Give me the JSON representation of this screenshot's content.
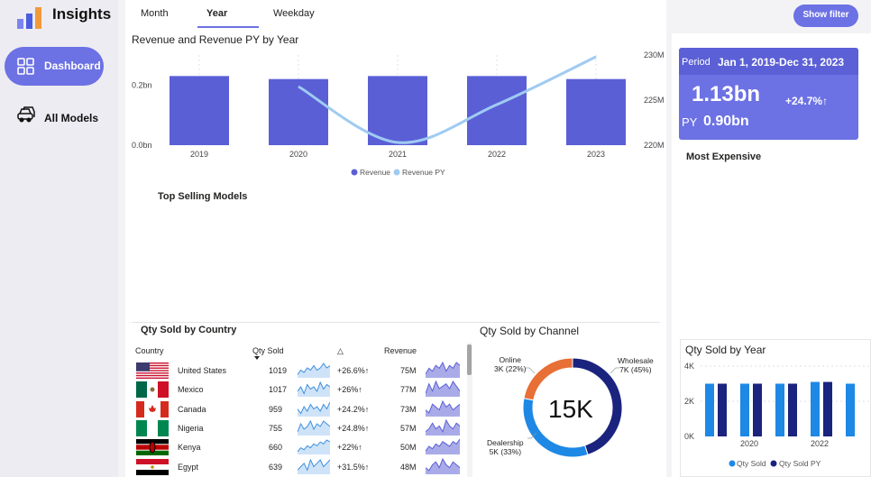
{
  "app": {
    "title": "Insights"
  },
  "nav": {
    "items": [
      {
        "label": "Dashboard",
        "active": true,
        "icon": "grid-icon"
      },
      {
        "label": "All Models",
        "active": false,
        "icon": "cars-icon"
      }
    ]
  },
  "tabs": [
    {
      "label": "Month"
    },
    {
      "label": "Year",
      "selected": true
    },
    {
      "label": "Weekday"
    }
  ],
  "filter_button": "Show filter",
  "colors": {
    "accent": "#6c71e4",
    "bar": "#5b5fd6",
    "line": "#9fcbf2",
    "dark_blue": "#1a237e",
    "orange": "#e86f35",
    "bright_blue": "#1e88e5"
  },
  "revenue_chart": {
    "title": "Revenue and Revenue PY by Year",
    "legend": [
      "Revenue",
      "Revenue PY"
    ]
  },
  "chart_data": [
    {
      "type": "bar",
      "title": "Revenue and Revenue PY by Year",
      "categories": [
        "2019",
        "2020",
        "2021",
        "2022",
        "2023"
      ],
      "series": [
        {
          "name": "Revenue",
          "values": [
            0.23,
            0.22,
            0.23,
            0.23,
            0.22
          ],
          "axis": "left"
        },
        {
          "name": "Revenue PY",
          "type": "line",
          "values": [
            null,
            226.5,
            220.3,
            224.5,
            229.8
          ],
          "axis": "right"
        }
      ],
      "y_left_ticks": [
        "0.0bn",
        "0.2bn"
      ],
      "y_left_range": [
        0,
        0.3
      ],
      "y_right_ticks": [
        "220M",
        "225M",
        "230M"
      ],
      "y_right_range": [
        220,
        230
      ],
      "legend_position": "bottom"
    },
    {
      "type": "pie",
      "title": "Qty Sold by Channel",
      "center_label": "15K",
      "slices": [
        {
          "name": "Wholesale",
          "value": "7K",
          "percent": "45%",
          "share": 45
        },
        {
          "name": "Dealership",
          "value": "5K",
          "percent": "33%",
          "share": 33
        },
        {
          "name": "Online",
          "value": "3K",
          "percent": "22%",
          "share": 22
        }
      ]
    },
    {
      "type": "bar",
      "title": "Qty Sold by Year",
      "categories": [
        "2019",
        "2020",
        "2021",
        "2022",
        "2023"
      ],
      "tick_labels": [
        "2020",
        "2022"
      ],
      "series": [
        {
          "name": "Qty Sold",
          "values": [
            3000,
            3000,
            3000,
            3100,
            3000
          ]
        },
        {
          "name": "Qty Sold PY",
          "values": [
            null,
            3000,
            3000,
            3000,
            3100
          ]
        }
      ],
      "y_ticks": [
        "0K",
        "2K",
        "4K"
      ],
      "ylim": [
        0,
        4000
      ],
      "legend_position": "bottom"
    }
  ],
  "kpi": {
    "period_label": "Period",
    "period_value": "Jan 1, 2019-Dec 31, 2023",
    "value": "1.13bn",
    "change": "+24.7%",
    "py_label": "PY",
    "py_value": "0.90bn"
  },
  "most_expensive": {
    "title": "Most Expensive"
  },
  "top_selling": {
    "title": "Top Selling Models"
  },
  "country_table": {
    "title": "Qty Sold by Country",
    "headers": [
      "Country",
      "Qty Sold",
      "△",
      "Revenue"
    ],
    "rows": [
      {
        "country": "United States",
        "flag": "us",
        "qty": "1019",
        "change": "+26.6%",
        "revenue": "75M",
        "spark": [
          3,
          5,
          4,
          6,
          5,
          7,
          5,
          6,
          8,
          6,
          7
        ],
        "spark2": [
          4,
          6,
          5,
          7,
          6,
          8,
          5,
          7,
          6,
          8,
          7
        ]
      },
      {
        "country": "Mexico",
        "flag": "mx",
        "qty": "1017",
        "change": "+26%",
        "revenue": "77M",
        "spark": [
          4,
          6,
          3,
          7,
          5,
          6,
          4,
          8,
          5,
          7,
          6
        ],
        "spark2": [
          3,
          7,
          4,
          8,
          5,
          6,
          7,
          5,
          8,
          6,
          4
        ]
      },
      {
        "country": "Canada",
        "flag": "ca",
        "qty": "959",
        "change": "+24.2%",
        "revenue": "73M",
        "spark": [
          5,
          3,
          6,
          4,
          7,
          5,
          6,
          4,
          7,
          5,
          8
        ],
        "spark2": [
          5,
          4,
          7,
          6,
          5,
          8,
          6,
          7,
          5,
          6,
          7
        ]
      },
      {
        "country": "Nigeria",
        "flag": "ng",
        "qty": "755",
        "change": "+24.8%",
        "revenue": "57M",
        "spark": [
          3,
          6,
          4,
          5,
          7,
          4,
          6,
          5,
          7,
          6,
          5
        ],
        "spark2": [
          4,
          5,
          7,
          5,
          6,
          4,
          8,
          6,
          5,
          7,
          6
        ]
      },
      {
        "country": "Kenya",
        "flag": "ke",
        "qty": "660",
        "change": "+22%",
        "revenue": "50M",
        "spark": [
          2,
          4,
          3,
          5,
          4,
          6,
          5,
          7,
          6,
          8,
          7
        ],
        "spark2": [
          3,
          5,
          4,
          6,
          5,
          7,
          6,
          5,
          7,
          6,
          8
        ]
      },
      {
        "country": "Egypt",
        "flag": "eg",
        "qty": "639",
        "change": "+31.5%",
        "revenue": "48M",
        "spark": [
          4,
          5,
          6,
          4,
          7,
          5,
          6,
          7,
          5,
          6,
          7
        ],
        "spark2": [
          5,
          4,
          6,
          7,
          5,
          8,
          6,
          5,
          7,
          6,
          5
        ]
      }
    ]
  }
}
